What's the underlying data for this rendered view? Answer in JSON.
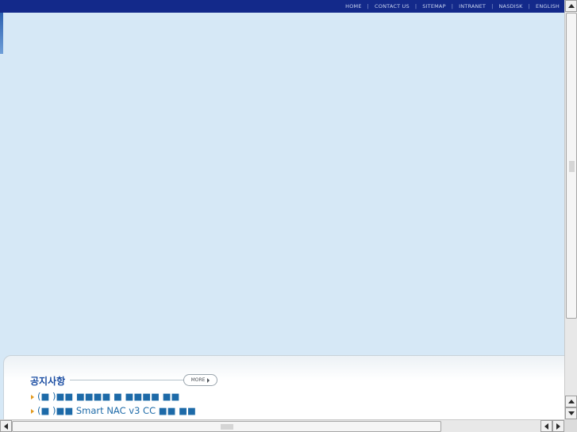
{
  "top_nav": {
    "links": [
      "HOME",
      "CONTACT US",
      "SITEMAP",
      "INTRANET",
      "NASDISK",
      "ENGLISH"
    ],
    "separator": "|"
  },
  "notice": {
    "title": "공지사항",
    "more_label": "MORE",
    "items": [
      "(■ )■■ ■■■■ ■ ■■■■ ■■",
      "(■ )■■ Smart NAC v3 CC ■■ ■■"
    ]
  },
  "colors": {
    "nav_bar": "#13298a",
    "page_background": "#d6e8f6",
    "notice_title": "#1d4fa3",
    "notice_link": "#1d6aa8",
    "bullet": "#e29a1e"
  },
  "icons": {
    "bullet": "orange-triangle",
    "more": "right-triangle",
    "scroll_up": "up-arrow",
    "scroll_down": "down-arrow",
    "scroll_left": "left-arrow",
    "scroll_right": "right-arrow"
  }
}
